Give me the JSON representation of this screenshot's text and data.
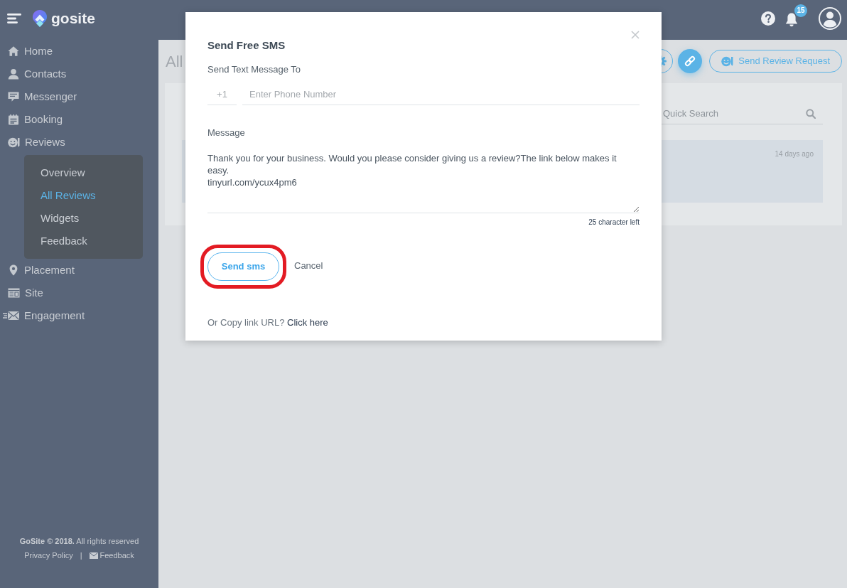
{
  "header": {
    "logo_text": "gosite",
    "notification_count": "15"
  },
  "sidebar": {
    "items": [
      {
        "label": "Home",
        "selected": false
      },
      {
        "label": "Contacts",
        "selected": false
      },
      {
        "label": "Messenger",
        "selected": false
      },
      {
        "label": "Booking",
        "selected": false
      },
      {
        "label": "Reviews",
        "selected": false,
        "expanded": true,
        "children": [
          {
            "label": "Overview",
            "selected": false
          },
          {
            "label": "All Reviews",
            "selected": true
          },
          {
            "label": "Widgets",
            "selected": false
          },
          {
            "label": "Feedback",
            "selected": false
          }
        ]
      },
      {
        "label": "Placement",
        "selected": false
      },
      {
        "label": "Site",
        "selected": false
      },
      {
        "label": "Engagement",
        "selected": false
      }
    ],
    "footer": {
      "copyright": "**GoSite © 2018.** All rights reserved",
      "links": [
        {
          "label": "Privacy Policy",
          "kind": "plain"
        },
        {
          "label": "Feedback",
          "kind": "mail"
        }
      ],
      "separator": "|"
    }
  },
  "page": {
    "title": "All",
    "review_request_button": "Send Review Request",
    "search": {
      "placeholder": "Quick Search"
    },
    "reviews": [
      {
        "time": "14 days ago"
      }
    ]
  },
  "modal": {
    "title": "Send Free SMS",
    "recipient_label": "Send Text Message To",
    "country_code": "+1",
    "phone": {
      "placeholder": "Enter Phone Number"
    },
    "message_label": "Message",
    "message": {
      "value": "Thank you for your business. Would you please consider giving us a review?The link below makes it easy.\ntinyurl.com/ycux4pm6"
    },
    "characters_left": "25 character left",
    "send_button": {
      "label": "Send sms",
      "highlighted": true
    },
    "cancel_button": "Cancel",
    "copy_link": {
      "text": "Or Copy link URL?",
      "link": "Click here"
    }
  }
}
